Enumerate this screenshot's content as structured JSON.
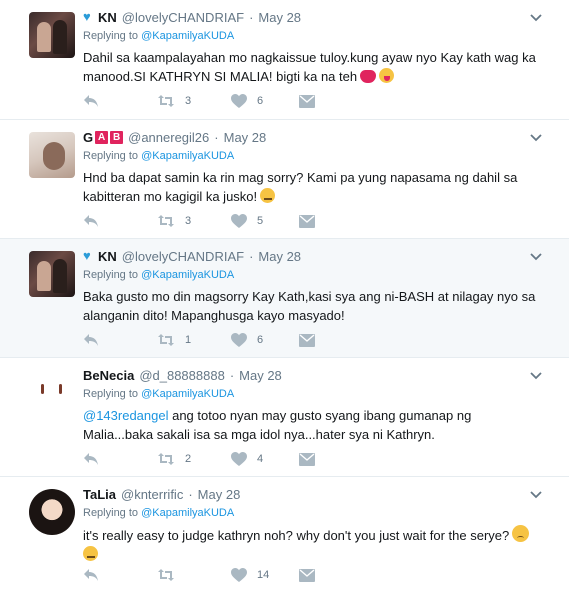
{
  "colors": {
    "link": "#1b95e0",
    "icon": "#aab8c2",
    "muted": "#657786",
    "badge_red": "#e0245e",
    "heart_badge": "#2c9cd8"
  },
  "tweets": [
    {
      "name": "KN",
      "handle": "@lovelyCHANDRIAF",
      "time": "May 28",
      "reply_prefix": "Replying to",
      "reply_to": "@KapamilyaKUDA",
      "text": "Dahil sa kaampalayahan mo nagkaissue tuloy.kung ayaw nyo Kay kath wag ka manood.SI KATHRYN SI MALIA! bigti ka na teh",
      "retweets": "3",
      "likes": "6",
      "emojis": [
        "devil",
        "tongue"
      ]
    },
    {
      "name": "",
      "name_badges": [
        "A",
        "B"
      ],
      "name_prefix": "G",
      "handle": "@anneregil26",
      "time": "May 28",
      "reply_prefix": "Replying to",
      "reply_to": "@KapamilyaKUDA",
      "text": "Hnd ba dapat samin ka rin mag sorry? Kami pa yung napasama ng dahil sa kabitteran mo kagigil ka jusko!",
      "retweets": "3",
      "likes": "5",
      "emojis": [
        "unamused"
      ]
    },
    {
      "name": "KN",
      "handle": "@lovelyCHANDRIAF",
      "time": "May 28",
      "reply_prefix": "Replying to",
      "reply_to": "@KapamilyaKUDA",
      "text": "Baka gusto mo din magsorry Kay Kath,kasi sya ang ni-BASH at nilagay nyo sa alanganin dito! Mapanghusga kayo masyado!",
      "retweets": "1",
      "likes": "6"
    },
    {
      "name": "BeNecia",
      "handle": "@d_88888888",
      "time": "May 28",
      "reply_prefix": "Replying to",
      "reply_to": "@KapamilyaKUDA",
      "mention": "@143redangel",
      "text": " ang totoo nyan may gusto syang ibang gumanap ng Malia...baka sakali isa sa mga idol nya...hater sya ni Kathryn.",
      "retweets": "2",
      "likes": "4"
    },
    {
      "name": "TaLia",
      "handle": "@knterrific",
      "time": "May 28",
      "reply_prefix": "Replying to",
      "reply_to": "@KapamilyaKUDA",
      "text": "it's really easy to judge kathryn noh? why don't you just wait for the serye?",
      "retweets": "",
      "likes": "14",
      "emojis": [
        "sad",
        "unamused"
      ]
    }
  ]
}
